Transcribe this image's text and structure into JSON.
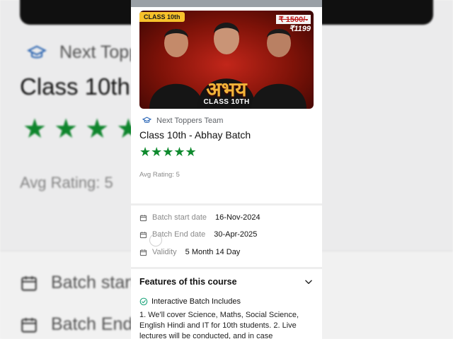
{
  "background": {
    "author": "Next Toppers",
    "title": "Class 10th",
    "stars": "★★★★★",
    "avg_rating": "Avg Rating: 5",
    "rows": [
      "Batch start",
      "Batch End"
    ]
  },
  "course": {
    "thumbnail": {
      "class_badge": "CLASS 10th",
      "old_price": "₹ 1500/-",
      "new_price": "₹1199",
      "banner_title": "अभय",
      "banner_subtitle": "CLASS 10TH"
    },
    "team": "Next Toppers Team",
    "title": "Class 10th - Abhay Batch",
    "rating_stars": 5,
    "stars": "★★★★★",
    "avg_rating": "Avg Rating: 5"
  },
  "batch_info": {
    "start_label": "Batch start date",
    "start_value": "16-Nov-2024",
    "end_label": "Batch End date",
    "end_value": "30-Apr-2025",
    "validity_label": "Validity",
    "validity_value": "5 Month 14 Day"
  },
  "features": {
    "heading": "Features of this course",
    "item_title": "Interactive Batch Includes",
    "item_desc": "1. We'll cover Science, Maths, Social Science, English Hindi and IT for 10th students. 2. Live lectures will be conducted, and in case"
  },
  "colors": {
    "star_green": "#0f8a2e",
    "check_teal": "#1aa37a"
  },
  "icons": [
    "graduation-cap-icon",
    "calendar-icon",
    "chevron-down-icon",
    "check-circle-icon"
  ]
}
